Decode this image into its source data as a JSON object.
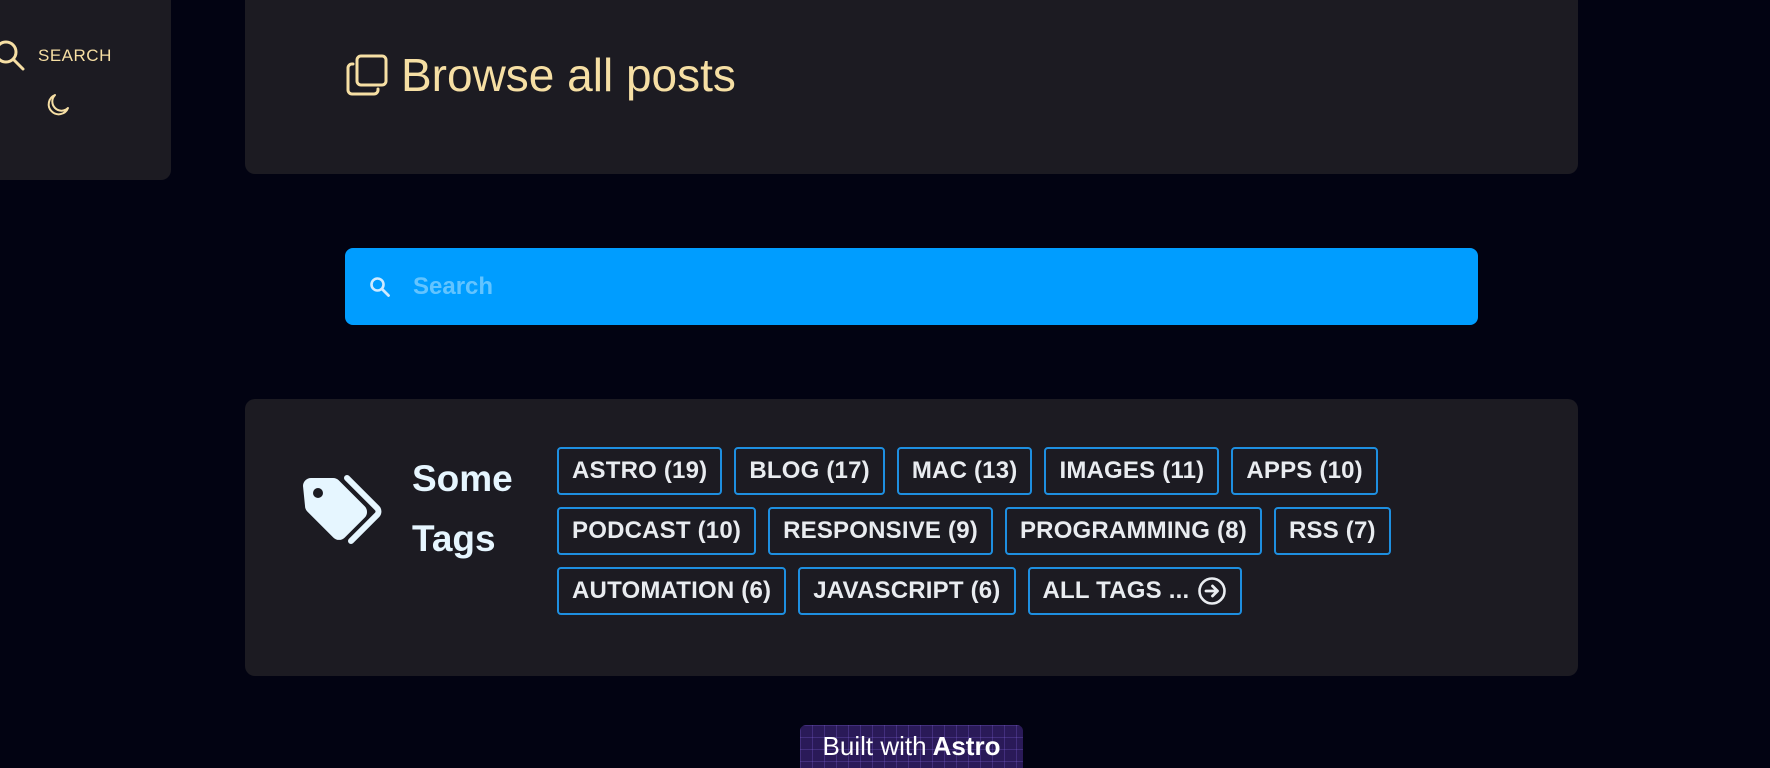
{
  "sidebar": {
    "search_label": "SEARCH",
    "icons": [
      "search-icon",
      "moon-icon"
    ]
  },
  "header": {
    "title": "Browse all posts",
    "icon": "copy-icon"
  },
  "search": {
    "placeholder": "Search",
    "icon": "search-icon"
  },
  "tags_section": {
    "title_line1": "Some",
    "title_line2": "Tags",
    "icon": "tags-icon",
    "tags": [
      "ASTRO (19)",
      "BLOG (17)",
      "MAC (13)",
      "IMAGES (11)",
      "APPS (10)",
      "PODCAST (10)",
      "RESPONSIVE (9)",
      "PROGRAMMING (8)",
      "RSS (7)",
      "AUTOMATION (6)",
      "JAVASCRIPT (6)"
    ],
    "all_tags_label": "ALL TAGS ..."
  },
  "footer": {
    "built_with": "Built with",
    "framework": "Astro"
  },
  "colors": {
    "page_bg": "#020312",
    "card_bg": "#1c1b22",
    "accent_gold": "#f6dfa4",
    "search_blue": "#009dff",
    "tag_border": "#1e8fe0"
  }
}
